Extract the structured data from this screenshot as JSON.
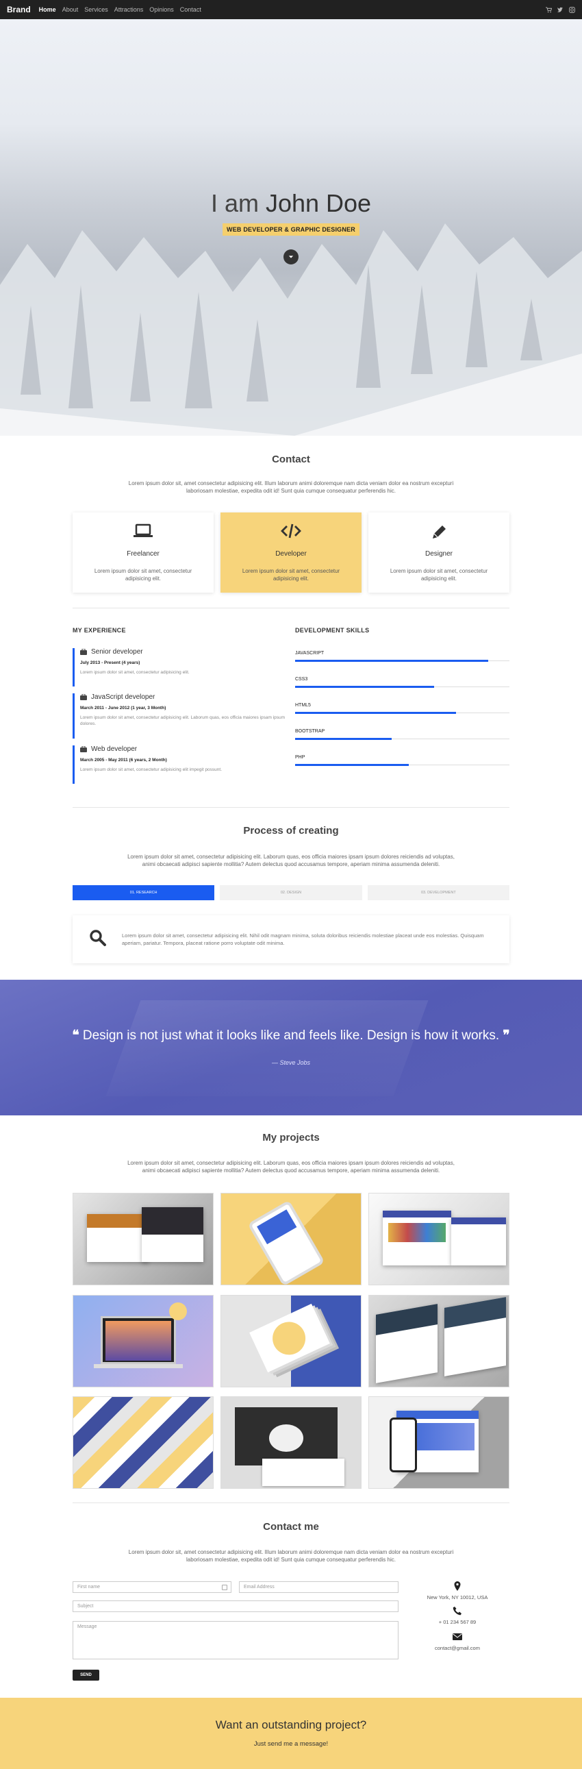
{
  "nav": {
    "brand": "Brand",
    "links": [
      "Home",
      "About",
      "Services",
      "Attractions",
      "Opinions",
      "Contact"
    ],
    "icons": [
      "shopping-cart-icon",
      "twitter-icon",
      "instagram-icon"
    ]
  },
  "hero": {
    "title_prefix": "I am ",
    "title_name": "John Doe",
    "tagline": "WEB DEVELOPER & GRAPHIC DESIGNER",
    "scroll_icon": "chevron-down-icon"
  },
  "contact_section": {
    "title": "Contact",
    "lead": "Lorem ipsum dolor sit, amet consectetur adipisicing elit. Illum laborum animi doloremque nam dicta veniam dolor ea nostrum excepturi laboriosam molestiae, expedita odit id! Sunt quia cumque consequatur perferendis hic.",
    "cards": [
      {
        "icon": "laptop-icon",
        "title": "Freelancer",
        "text": "Lorem ipsum dolor sit amet, consectetur adipisicing elit."
      },
      {
        "icon": "code-icon",
        "title": "Developer",
        "text": "Lorem ipsum dolor sit amet, consectetur adipisicing elit."
      },
      {
        "icon": "pencil-icon",
        "title": "Designer",
        "text": "Lorem ipsum dolor sit amet, consectetur adipisicing elit."
      }
    ]
  },
  "experience": {
    "title": "MY EXPERIENCE",
    "items": [
      {
        "role": "Senior developer",
        "date": "July 2013 - Present (4 years)",
        "desc": "Lorem ipsum dolor sit amet, consectetur adipisicing elit."
      },
      {
        "role": "JavaScript developer",
        "date": "March 2011 - June 2012 (1 year, 3 Month)",
        "desc": "Lorem ipsum dolor sit amet, consectetur adipisicing elit. Laborum quas, eos officia maiores ipsam ipsum dolores."
      },
      {
        "role": "Web developer",
        "date": "March 2005 - May 2011 (6 years, 2 Month)",
        "desc": "Lorem ipsum dolor sit amet, consectetur adipisicing elit impegit possunt."
      }
    ]
  },
  "skills": {
    "title": "DEVELOPMENT SKILLS",
    "items": [
      {
        "name": "JAVASCRIPT",
        "level": 0.9
      },
      {
        "name": "CSS3",
        "level": 0.65
      },
      {
        "name": "HTML5",
        "level": 0.75
      },
      {
        "name": "BOOTSTRAP",
        "level": 0.45
      },
      {
        "name": "PHP",
        "level": 0.53
      }
    ]
  },
  "process": {
    "title": "Process of creating",
    "lead": "Lorem ipsum dolor sit amet, consectetur adipisicing elit. Laborum quas, eos officia maiores ipsam ipsum dolores reiciendis ad voluptas, animi obcaecati adipisci sapiente mollitia? Autem delectus quod accusamus tempore, aperiam minima assumenda deleniti.",
    "tabs": [
      "01. RESEARCH",
      "02. DESIGN",
      "03. DEVELOPMENT"
    ],
    "active_tab": 0,
    "panel_icon": "search-icon",
    "panel_text": "Lorem ipsum dolor sit amet, consectetur adipisicing elit. Nihil odit magnam minima, soluta doloribus reiciendis molestiae placeat unde eos molestias. Quisquam aperiam, pariatur. Tempora, placeat ratione porro voluptate odit minima."
  },
  "quote": {
    "text": "Design is not just what it looks like and feels like. Design is how it works.",
    "author": "— Steve Jobs",
    "open_icon": "quote-left-icon",
    "close_icon": "quote-right-icon"
  },
  "projects": {
    "title": "My projects",
    "lead": "Lorem ipsum dolor sit amet, consectetur adipisicing elit. Laborum quas, eos officia maiores ipsam ipsum dolores reiciendis ad voluptas, animi obcaecati adipisci sapiente mollitia? Autem delectus quod accusamus tempore, aperiam minima assumenda deleniti.",
    "thumb_labels": [
      "project-1",
      "project-2",
      "project-3",
      "project-4",
      "project-5",
      "project-6",
      "project-7",
      "project-8",
      "project-9"
    ]
  },
  "contact_me": {
    "title": "Contact me",
    "lead": "Lorem ipsum dolor sit, amet consectetur adipisicing elit. Illum laborum animi doloremque nam dicta veniam dolor ea nostrum excepturi laboriosam molestiae, expedita odit id! Sunt quia cumque consequatur perferendis hic.",
    "first_name_placeholder": "First name",
    "email_placeholder": "Email Address",
    "subject_placeholder": "Subject",
    "message_placeholder": "Message",
    "send_label": "SEND",
    "address": "New York, NY 10012, USA",
    "phone": "+ 01 234 567 89",
    "email": "contact@gmail.com"
  },
  "footer": {
    "title": "Want an outstanding project?",
    "subtitle": "Just send me a message!"
  },
  "colors": {
    "accent_blue": "#1a5cf0",
    "accent_yellow": "#f7d47b",
    "quote_bg": "#5a60b8",
    "nav_bg": "#212121"
  }
}
